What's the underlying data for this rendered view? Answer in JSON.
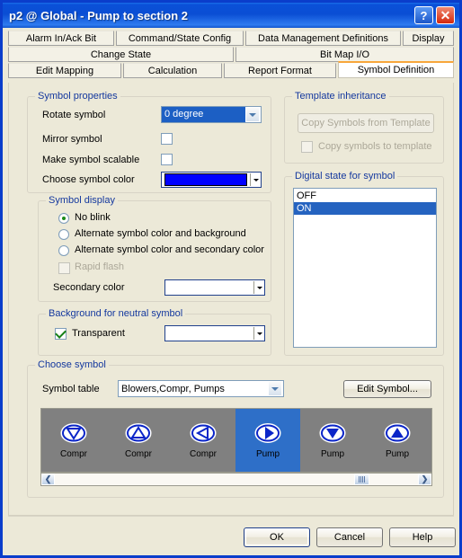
{
  "window": {
    "title": "p2 @ Global - Pump to section 2",
    "help_btn": "?",
    "close_btn": "✕"
  },
  "tabs": {
    "row1": [
      {
        "label": "Alarm In/Ack Bit",
        "active": false
      },
      {
        "label": "Command/State Config",
        "active": false
      },
      {
        "label": "Data Management Definitions",
        "active": false
      },
      {
        "label": "Display",
        "active": false
      }
    ],
    "row2": [
      {
        "label": "Change State",
        "active": false
      },
      {
        "label": "Bit Map I/O",
        "active": false
      }
    ],
    "row3": [
      {
        "label": "Edit Mapping",
        "active": false
      },
      {
        "label": "Calculation",
        "active": false
      },
      {
        "label": "Report Format",
        "active": false
      },
      {
        "label": "Symbol Definition",
        "active": true
      }
    ]
  },
  "symbol_properties": {
    "legend": "Symbol properties",
    "rotate_label": "Rotate symbol",
    "rotate_value": "0 degree",
    "mirror_label": "Mirror symbol",
    "mirror_checked": false,
    "scalable_label": "Make symbol scalable",
    "scalable_checked": false,
    "color_label": "Choose symbol color",
    "color_value": "#0000FF"
  },
  "symbol_display": {
    "legend": "Symbol display",
    "options": [
      {
        "label": "No blink",
        "selected": true
      },
      {
        "label": "Alternate symbol color and background",
        "selected": false
      },
      {
        "label": "Alternate symbol color and secondary color",
        "selected": false
      }
    ],
    "rapid_flash_label": "Rapid flash",
    "rapid_flash_checked": false,
    "rapid_flash_enabled": false,
    "secondary_label": "Secondary color",
    "secondary_value": ""
  },
  "background_group": {
    "legend": "Background for neutral symbol",
    "transparent_label": "Transparent",
    "transparent_checked": true,
    "color_value": ""
  },
  "template_inheritance": {
    "legend": "Template inheritance",
    "copy_from_button": "Copy Symbols from Template",
    "copy_to_label": "Copy symbols to template",
    "copy_to_checked": false,
    "enabled": false
  },
  "digital_state": {
    "legend": "Digital state for symbol",
    "items": [
      {
        "label": "OFF",
        "selected": false
      },
      {
        "label": "ON",
        "selected": true
      }
    ]
  },
  "choose_symbol": {
    "legend": "Choose symbol",
    "table_label": "Symbol table",
    "table_value": "Blowers,Compr, Pumps",
    "edit_button": "Edit Symbol...",
    "symbols": [
      {
        "name": "Compr",
        "glyph": "triangle-down",
        "selected": false
      },
      {
        "name": "Compr",
        "glyph": "triangle-up",
        "selected": false
      },
      {
        "name": "Compr",
        "glyph": "triangle-left",
        "selected": false
      },
      {
        "name": "Pump",
        "glyph": "triangle-right",
        "selected": true
      },
      {
        "name": "Pump",
        "glyph": "triangle-down",
        "selected": false
      },
      {
        "name": "Pump",
        "glyph": "triangle-up",
        "selected": false
      }
    ],
    "scroll_left": "❮",
    "scroll_right": "❯"
  },
  "footer": {
    "ok": "OK",
    "cancel": "Cancel",
    "help": "Help"
  },
  "colors": {
    "titlebar": "#0A4ED4",
    "accent": "#2563C0",
    "group_label": "#14389E",
    "face": "#ECE9D8",
    "symbol_blue": "#0A25C8"
  }
}
